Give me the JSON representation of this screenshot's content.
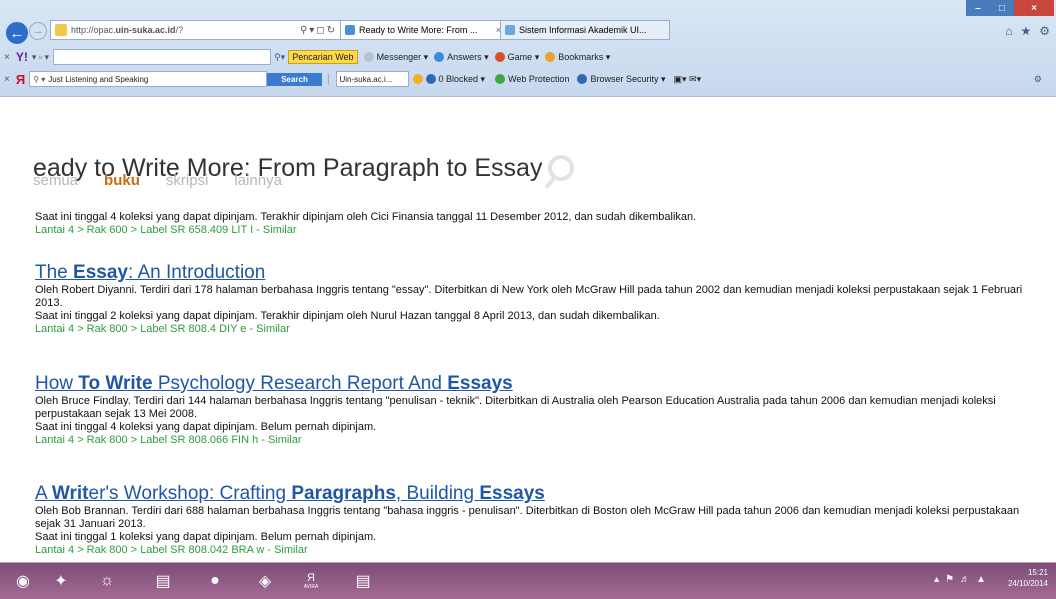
{
  "browser": {
    "url_prefix": "http://opac.",
    "url_domain": "uin-suka.ac.id",
    "url_suffix": "/?",
    "tabs": [
      {
        "label": "Ready to Write More: From ..."
      },
      {
        "label": "Sistem Informasi Akademik UI..."
      }
    ],
    "toolbar1": {
      "pencarian": "Pencarian Web",
      "messenger": "Messenger",
      "answers": "Answers",
      "game": "Game",
      "bookmarks": "Bookmarks"
    },
    "toolbar2": {
      "search_value": "Just Listening and Speaking",
      "search_button": "Search",
      "site": "Uin-suka.ac.i...",
      "blocked": "0 Blocked",
      "webprotection": "Web Protection",
      "browsersecurity": "Browser Security"
    }
  },
  "page": {
    "query": "eady to Write More: From Paragraph to Essay",
    "categories": [
      "semua",
      "buku",
      "skripsi",
      "lainnya"
    ],
    "first_item": {
      "availability": "Saat ini tinggal 4 koleksi yang dapat dipinjam. Terakhir dipinjam oleh Cici Finansia tanggal 11 Desember 2012, dan sudah dikembalikan.",
      "location": "Lantai 4  >  Rak 600  >  Label SR 658.409 LIT I  -  Similar"
    },
    "results": [
      {
        "title_parts": [
          "The ",
          "Essay",
          ": An Introduction"
        ],
        "desc": "Oleh Robert Diyanni. Terdiri dari 178 halaman berbahasa Inggris tentang \"essay\". Diterbitkan di New York oleh McGraw Hill pada tahun 2002 dan kemudian menjadi koleksi perpustakaan sejak 1 Februari 2013.",
        "availability": "Saat ini tinggal 2 koleksi yang dapat dipinjam. Terakhir dipinjam oleh Nurul Hazan tanggal 8 April 2013, dan sudah dikembalikan.",
        "location": "Lantai 4  >  Rak 800  >  Label SR 808.4 DIY e  -  Similar"
      },
      {
        "title_parts": [
          "How ",
          "To Write",
          " Psychology Research Report And ",
          "Essays"
        ],
        "desc": "Oleh Bruce Findlay. Terdiri dari 144 halaman berbahasa Inggris tentang \"penulisan - teknik\". Diterbitkan di Australia oleh Pearson Education Australia pada tahun 2006 dan kemudian menjadi koleksi perpustakaan sejak 13 Mei 2008.",
        "availability": "Saat ini tinggal 4 koleksi yang dapat dipinjam. Belum pernah dipinjam.",
        "location": "Lantai 4  >  Rak 800  >  Label SR 808.066 FIN h  -  Similar"
      },
      {
        "title_parts": [
          "A ",
          "Writ",
          "er's Workshop: Crafting ",
          "Paragraphs",
          ", Building ",
          "Essays"
        ],
        "desc": "Oleh Bob Brannan. Terdiri dari 688 halaman berbahasa Inggris tentang \"bahasa inggris - penulisan\". Diterbitkan di Boston oleh McGraw Hill pada tahun 2006 dan kemudian menjadi koleksi perpustakaan sejak 31 Januari 2013.",
        "availability": "Saat ini tinggal 1 koleksi yang dapat dipinjam. Belum pernah dipinjam.",
        "location": "Lantai 4  >  Rak 800  >  Label SR 808.042 BRA w  -  Similar"
      }
    ]
  },
  "taskbar": {
    "time": "15:21",
    "date": "24/10/2014",
    "avira": "AVIRA"
  },
  "colors": {
    "link": "#1f57a6",
    "location": "#2e9d3a",
    "active_cat": "#c86b14",
    "taskbar": "#8e5a85"
  }
}
